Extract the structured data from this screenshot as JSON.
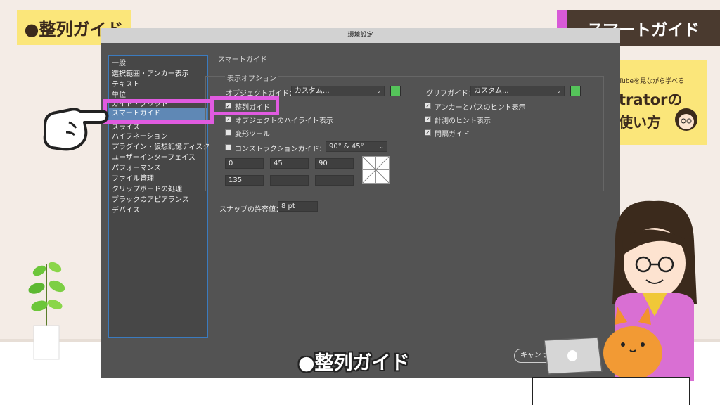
{
  "overlay": {
    "top_left_badge": "●整列ガイド",
    "top_right_badge": "スマートガイド",
    "promo_line1": "Tubeを見ながら学べる",
    "promo_line2": "trator​の",
    "promo_line3": "使い方",
    "bottom_caption": "●整列ガイド"
  },
  "dialog": {
    "title": "環境設定",
    "sidebar_items": [
      "一般",
      "選択範囲・アンカー表示",
      "テキスト",
      "単位",
      "ガイド・グリッド",
      "スマートガイド",
      "スライス",
      "ハイフネーション",
      "プラグイン・仮想記憶ディスク",
      "ユーザーインターフェイス",
      "パフォーマンス",
      "ファイル管理",
      "クリップボードの処理",
      "ブラックのアピアランス",
      "デバイス"
    ],
    "selected_item": "スマートガイド",
    "section_title": "スマートガイド",
    "group_title": "表示オプション",
    "object_guide_label": "オブジェクトガイド：",
    "object_guide_value": "カスタム...",
    "glyph_guide_label": "グリフガイド：",
    "glyph_guide_value": "カスタム...",
    "checks_left": [
      {
        "label": "整列ガイド",
        "checked": true
      },
      {
        "label": "オブジェクトのハイライト表示",
        "checked": true
      },
      {
        "label": "変形ツール",
        "checked": false
      }
    ],
    "construction_label": "コンストラクションガイド：",
    "construction_checked": false,
    "construction_value": "90° & 45°",
    "angles": [
      "0",
      "45",
      "90",
      "135",
      "",
      ""
    ],
    "checks_right": [
      {
        "label": "アンカーとパスのヒント表示",
        "checked": true
      },
      {
        "label": "計測のヒント表示",
        "checked": true
      },
      {
        "label": "間隔ガイド",
        "checked": true
      }
    ],
    "snap_label": "スナップの許容値：",
    "snap_value": "8 pt",
    "cancel_label": "キャンセ"
  },
  "colors": {
    "swatch": "#55c45a",
    "highlight": "#e05be0",
    "selection": "#5f88b5"
  }
}
